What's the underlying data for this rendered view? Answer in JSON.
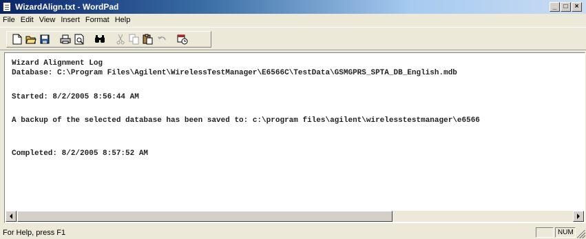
{
  "window": {
    "title": "WizardAlign.txt - WordPad",
    "controls": {
      "minimize": "_",
      "maximize": "□",
      "close": "×"
    }
  },
  "menu": [
    "File",
    "Edit",
    "View",
    "Insert",
    "Format",
    "Help"
  ],
  "toolbar": {
    "buttons": [
      {
        "name": "new",
        "icon": "new-document-icon",
        "enabled": true
      },
      {
        "name": "open",
        "icon": "open-folder-icon",
        "enabled": true
      },
      {
        "name": "save",
        "icon": "save-disk-icon",
        "enabled": true
      },
      {
        "name": "print",
        "icon": "printer-icon",
        "enabled": true
      },
      {
        "name": "print-preview",
        "icon": "print-preview-icon",
        "enabled": true
      },
      {
        "name": "find",
        "icon": "binoculars-icon",
        "enabled": true
      },
      {
        "name": "cut",
        "icon": "scissors-icon",
        "enabled": false
      },
      {
        "name": "copy",
        "icon": "copy-icon",
        "enabled": false
      },
      {
        "name": "paste",
        "icon": "paste-clipboard-icon",
        "enabled": true
      },
      {
        "name": "undo",
        "icon": "undo-arrow-icon",
        "enabled": false
      },
      {
        "name": "date-time",
        "icon": "date-time-icon",
        "enabled": true
      }
    ]
  },
  "document": {
    "lines": [
      "Wizard Alignment Log",
      "Database: C:\\Program Files\\Agilent\\WirelessTestManager\\E6566C\\TestData\\GSMGPRS_SPTA_DB_English.mdb",
      "",
      "Started: 8/2/2005 8:56:44 AM",
      "",
      "A backup of the selected database has been saved to: c:\\program files\\agilent\\wirelesstestmanager\\e6566",
      "",
      "",
      "Completed: 8/2/2005 8:57:52 AM"
    ]
  },
  "statusbar": {
    "help": "For Help, press F1",
    "num": "NUM"
  }
}
